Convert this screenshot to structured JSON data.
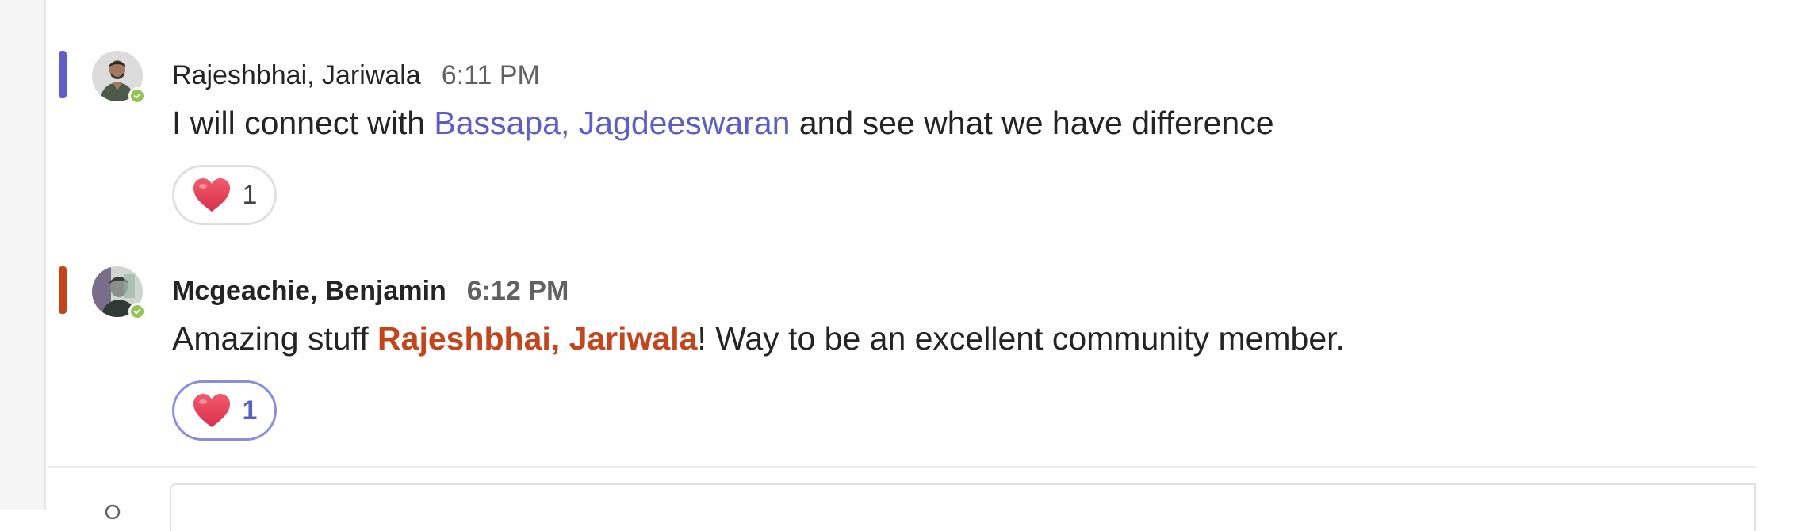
{
  "messages": [
    {
      "author": "Rajeshbhai, Jariwala",
      "time": "6:11 PM",
      "text_before": "I will connect with ",
      "mention": "Bassapa, Jagdeeswaran",
      "text_after": " and see what we have difference",
      "reaction": {
        "icon": "heart-icon",
        "count": "1"
      },
      "accent_color": "#5b5fc7",
      "presence": "available"
    },
    {
      "author": "Mcgeachie, Benjamin",
      "time": "6:12 PM",
      "text_before": "Amazing stuff ",
      "mention": "Rajeshbhai, Jariwala",
      "text_after": "! Way to be an excellent community member.",
      "reaction": {
        "icon": "heart-icon",
        "count": "1"
      },
      "accent_color": "#c4441c",
      "presence": "available"
    }
  ],
  "colors": {
    "mention": "#5b5fc7",
    "mention_self": "#c4441c",
    "presence_available": "#92c353",
    "heart": "#e8445a"
  }
}
